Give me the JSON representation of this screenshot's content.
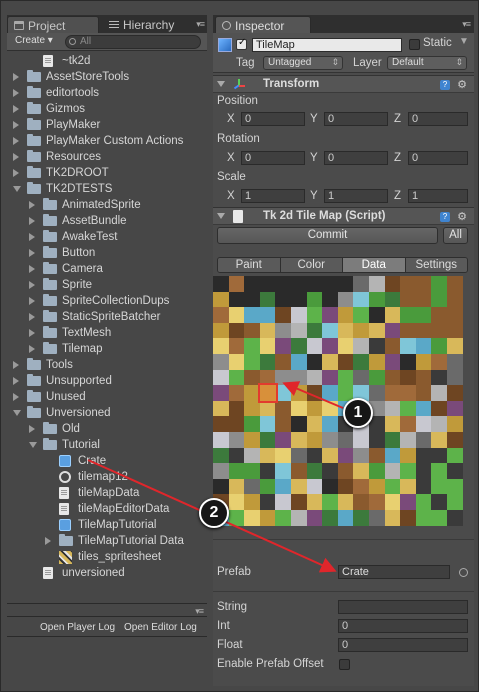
{
  "left_panel": {
    "tabs": {
      "project": "Project",
      "hierarchy": "Hierarchy"
    },
    "toolbar": {
      "create_label": "Create ▾",
      "search_placeholder": "All"
    },
    "tree": [
      {
        "label": "~tk2d",
        "kind": "file",
        "depth": 1,
        "arrow": "none"
      },
      {
        "label": "AssetStoreTools",
        "kind": "folder",
        "depth": 0,
        "arrow": "closed"
      },
      {
        "label": "editortools",
        "kind": "folder",
        "depth": 0,
        "arrow": "closed"
      },
      {
        "label": "Gizmos",
        "kind": "folder",
        "depth": 0,
        "arrow": "closed"
      },
      {
        "label": "PlayMaker",
        "kind": "folder",
        "depth": 0,
        "arrow": "closed"
      },
      {
        "label": "PlayMaker Custom Actions",
        "kind": "folder",
        "depth": 0,
        "arrow": "closed"
      },
      {
        "label": "Resources",
        "kind": "folder",
        "depth": 0,
        "arrow": "closed"
      },
      {
        "label": "TK2DROOT",
        "kind": "folder",
        "depth": 0,
        "arrow": "closed"
      },
      {
        "label": "TK2DTESTS",
        "kind": "folder",
        "depth": 0,
        "arrow": "open"
      },
      {
        "label": "AnimatedSprite",
        "kind": "folder",
        "depth": 1,
        "arrow": "closed"
      },
      {
        "label": "AssetBundle",
        "kind": "folder",
        "depth": 1,
        "arrow": "closed"
      },
      {
        "label": "AwakeTest",
        "kind": "folder",
        "depth": 1,
        "arrow": "closed"
      },
      {
        "label": "Button",
        "kind": "folder",
        "depth": 1,
        "arrow": "closed"
      },
      {
        "label": "Camera",
        "kind": "folder",
        "depth": 1,
        "arrow": "closed"
      },
      {
        "label": "Sprite",
        "kind": "folder",
        "depth": 1,
        "arrow": "closed"
      },
      {
        "label": "SpriteCollectionDups",
        "kind": "folder",
        "depth": 1,
        "arrow": "closed"
      },
      {
        "label": "StaticSpriteBatcher",
        "kind": "folder",
        "depth": 1,
        "arrow": "closed"
      },
      {
        "label": "TextMesh",
        "kind": "folder",
        "depth": 1,
        "arrow": "closed"
      },
      {
        "label": "Tilemap",
        "kind": "folder",
        "depth": 1,
        "arrow": "closed"
      },
      {
        "label": "Tools",
        "kind": "folder",
        "depth": 0,
        "arrow": "closed"
      },
      {
        "label": "Unsupported",
        "kind": "folder",
        "depth": 0,
        "arrow": "closed"
      },
      {
        "label": "Unused",
        "kind": "folder",
        "depth": 0,
        "arrow": "closed"
      },
      {
        "label": "Unversioned",
        "kind": "folder",
        "depth": 0,
        "arrow": "open"
      },
      {
        "label": "Old",
        "kind": "folder",
        "depth": 1,
        "arrow": "closed"
      },
      {
        "label": "Tutorial",
        "kind": "folder",
        "depth": 1,
        "arrow": "open"
      },
      {
        "label": "Crate",
        "kind": "cube",
        "depth": 2,
        "arrow": "none"
      },
      {
        "label": "tilemap12",
        "kind": "unity",
        "depth": 2,
        "arrow": "none"
      },
      {
        "label": "tileMapData",
        "kind": "file",
        "depth": 2,
        "arrow": "none"
      },
      {
        "label": "tileMapEditorData",
        "kind": "file",
        "depth": 2,
        "arrow": "none"
      },
      {
        "label": "TileMapTutorial",
        "kind": "cube",
        "depth": 2,
        "arrow": "none"
      },
      {
        "label": "TileMapTutorial Data",
        "kind": "folder",
        "depth": 2,
        "arrow": "closed"
      },
      {
        "label": "tiles_spritesheet",
        "kind": "sheet",
        "depth": 2,
        "arrow": "none"
      },
      {
        "label": "unversioned",
        "kind": "file",
        "depth": 1,
        "arrow": "none"
      }
    ],
    "console_buttons": {
      "player_log": "Open Player Log",
      "editor_log": "Open Editor Log"
    }
  },
  "inspector": {
    "tab_label": "Inspector",
    "object_name": "TileMap",
    "static_label": "Static",
    "tag_label": "Tag",
    "tag_value": "Untagged",
    "layer_label": "Layer",
    "layer_value": "Default",
    "transform": {
      "title": "Transform",
      "position_label": "Position",
      "rotation_label": "Rotation",
      "scale_label": "Scale",
      "x": "X",
      "y": "Y",
      "z": "Z",
      "position": [
        "0",
        "0",
        "0"
      ],
      "rotation": [
        "0",
        "0",
        "0"
      ],
      "scale": [
        "1",
        "1",
        "1"
      ]
    },
    "script": {
      "title": "Tk 2d Tile Map (Script)",
      "commit_label": "Commit",
      "all_label": "All",
      "tabs": [
        "Paint",
        "Color",
        "Data",
        "Settings"
      ],
      "selected_tab": "Data"
    },
    "data_fields": {
      "prefab_label": "Prefab",
      "prefab_value": "Crate",
      "string_label": "String",
      "string_value": "",
      "int_label": "Int",
      "int_value": "0",
      "float_label": "Float",
      "float_value": "0",
      "enable_prefab_offset_label": "Enable Prefab Offset"
    }
  },
  "annotations": {
    "badge1": "1",
    "badge2": "2",
    "arrow_color": "#e0262b"
  },
  "colors": {
    "accent_blue": "#3f84d0",
    "selected_tab": "#7c7c7c",
    "tile_highlight": "#e23b2e"
  }
}
